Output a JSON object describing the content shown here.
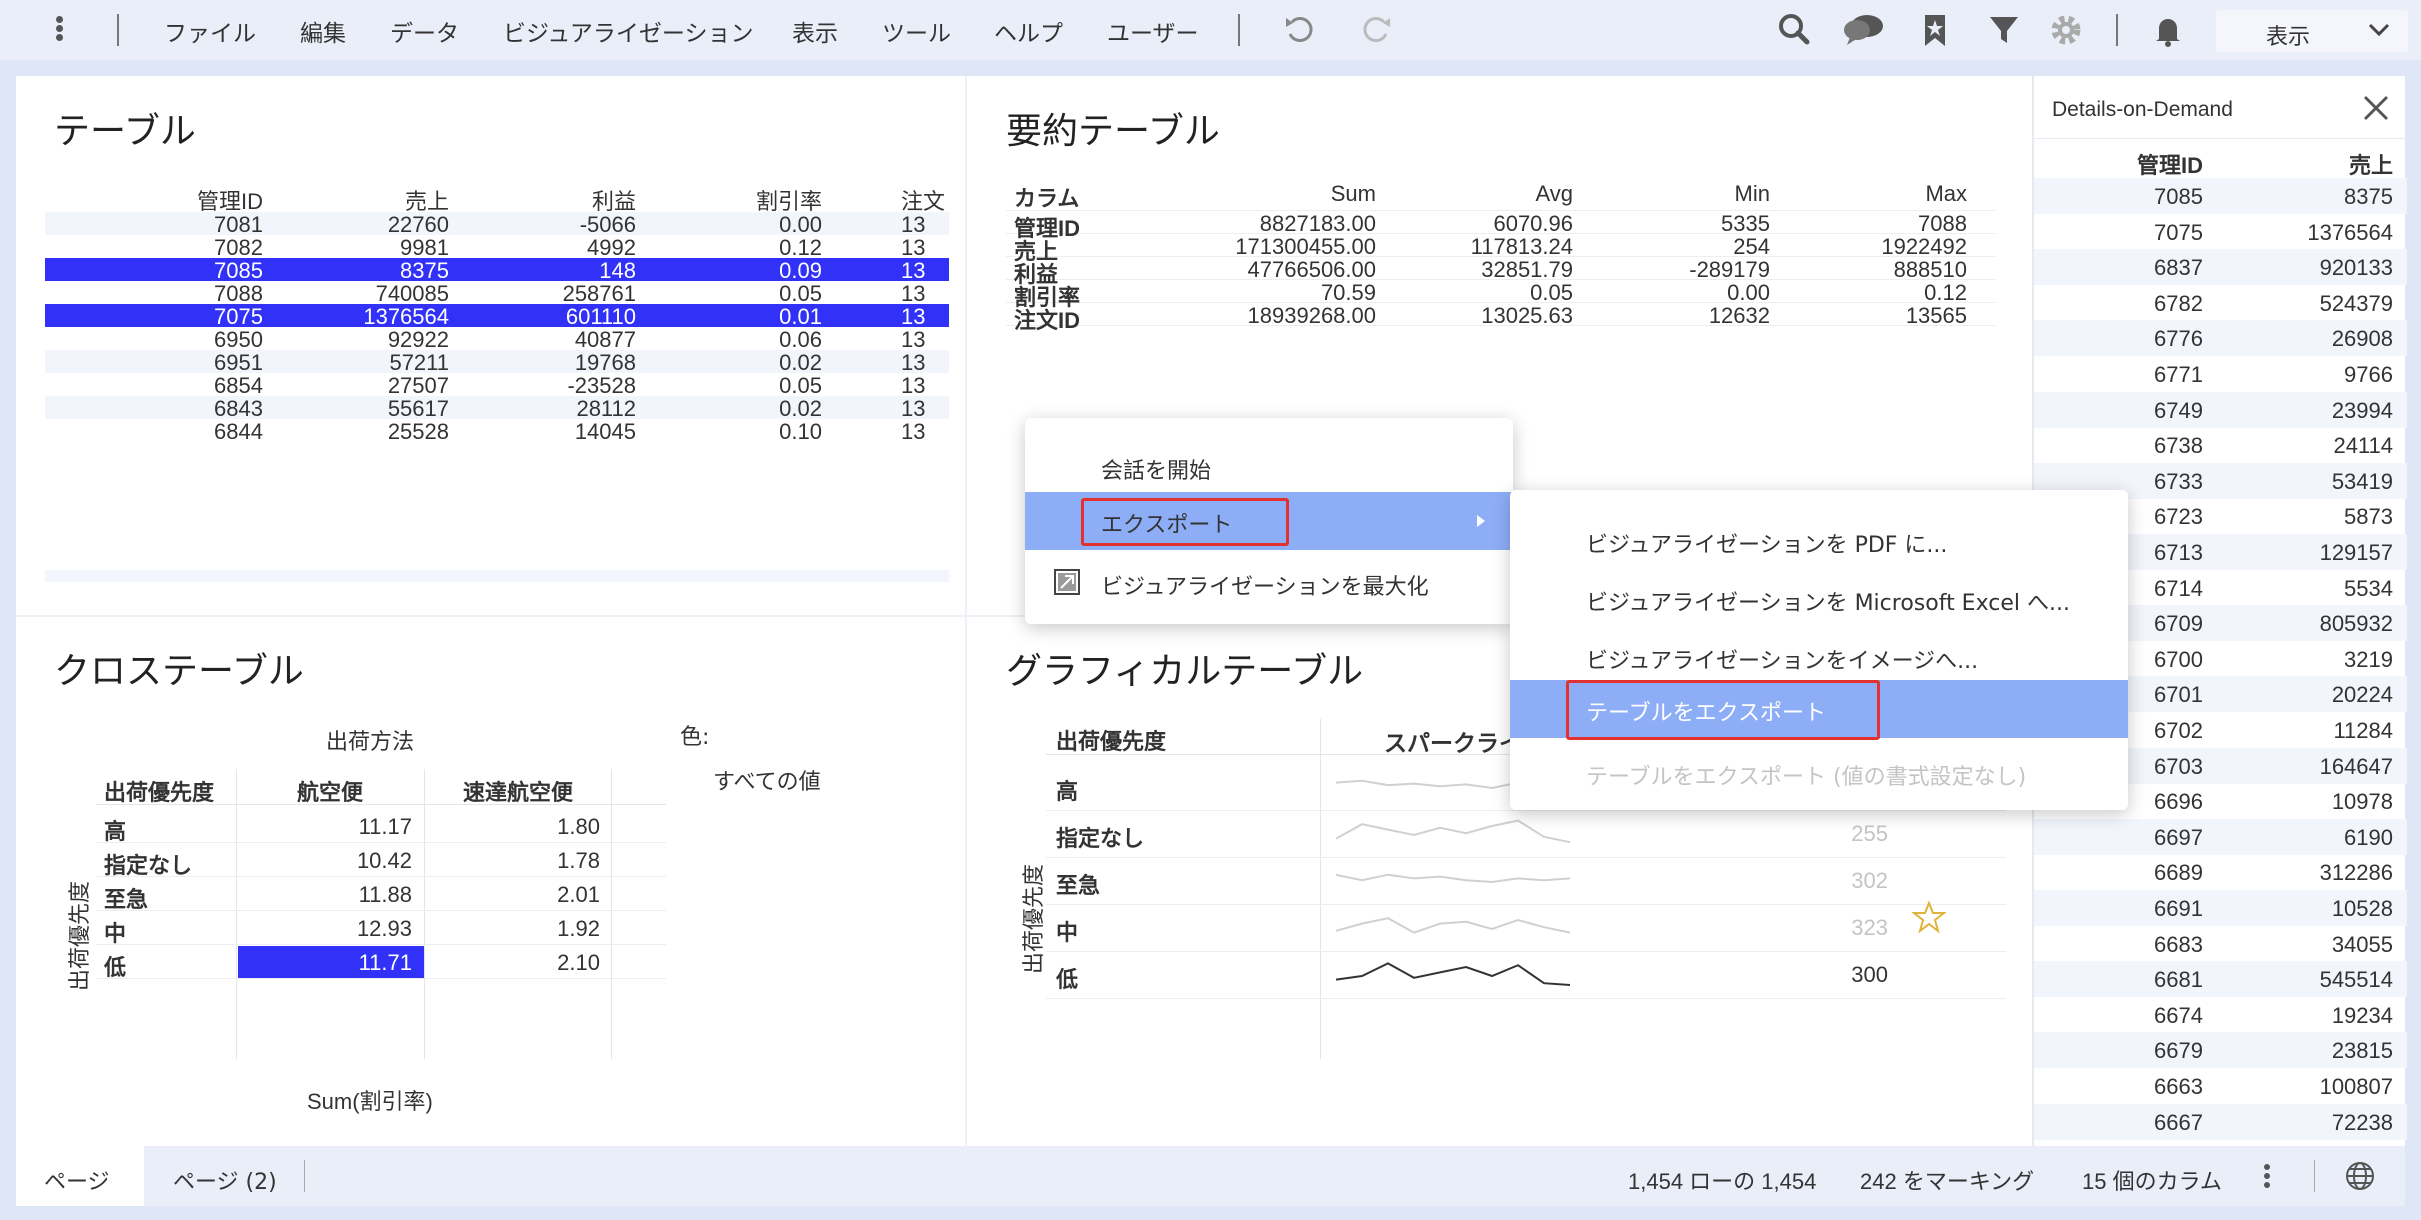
{
  "toolbar": {
    "menu": [
      "ファイル",
      "編集",
      "データ",
      "ビジュアライゼーション",
      "表示",
      "ツール",
      "ヘルプ",
      "ユーザー"
    ],
    "view_select": "表示"
  },
  "table_panel": {
    "title": "テーブル",
    "columns": [
      "管理ID",
      "売上",
      "利益",
      "割引率",
      "注文"
    ],
    "rows": [
      [
        "7081",
        "22760",
        "-5066",
        "0.00",
        "13"
      ],
      [
        "7082",
        "9981",
        "4992",
        "0.12",
        "13"
      ],
      [
        "7085",
        "8375",
        "148",
        "0.09",
        "13"
      ],
      [
        "7088",
        "740085",
        "258761",
        "0.05",
        "13"
      ],
      [
        "7075",
        "1376564",
        "601110",
        "0.01",
        "13"
      ],
      [
        "6950",
        "92922",
        "40877",
        "0.06",
        "13"
      ],
      [
        "6951",
        "57211",
        "19768",
        "0.02",
        "13"
      ],
      [
        "6854",
        "27507",
        "-23528",
        "0.05",
        "13"
      ],
      [
        "6843",
        "55617",
        "28112",
        "0.02",
        "13"
      ],
      [
        "6844",
        "25528",
        "14045",
        "0.10",
        "13"
      ]
    ],
    "selected_rows": [
      2,
      4
    ]
  },
  "summary_panel": {
    "title": "要約テーブル",
    "columns": [
      "カラム",
      "Sum",
      "Avg",
      "Min",
      "Max"
    ],
    "rows": [
      [
        "管理ID",
        "8827183.00",
        "6070.96",
        "5335",
        "7088"
      ],
      [
        "売上",
        "171300455.00",
        "117813.24",
        "254",
        "1922492"
      ],
      [
        "利益",
        "47766506.00",
        "32851.79",
        "-289179",
        "888510"
      ],
      [
        "割引率",
        "70.59",
        "0.05",
        "0.00",
        "0.12"
      ],
      [
        "注文ID",
        "18939268.00",
        "13025.63",
        "12632",
        "13565"
      ]
    ]
  },
  "cross_panel": {
    "title": "クロステーブル",
    "col_group": "出荷方法",
    "row_header": "出荷優先度",
    "columns": [
      "航空便",
      "速達航空便"
    ],
    "vertical_label": "出荷優先度",
    "rows": [
      [
        "高",
        "11.17",
        "1.80"
      ],
      [
        "指定なし",
        "10.42",
        "1.78"
      ],
      [
        "至急",
        "11.88",
        "2.01"
      ],
      [
        "中",
        "12.93",
        "1.92"
      ],
      [
        "低",
        "11.71",
        "2.10"
      ]
    ],
    "color_label": "色:",
    "color_value": "すべての値",
    "footer": "Sum(割引率)"
  },
  "graphical_panel": {
    "title": "グラフィカルテーブル",
    "row_header": "出荷優先度",
    "col_header": "スパークライ",
    "vertical_label": "出荷優先度",
    "rows": [
      {
        "label": "高",
        "value": ""
      },
      {
        "label": "指定なし",
        "value": "255"
      },
      {
        "label": "至急",
        "value": "302"
      },
      {
        "label": "中",
        "value": "323"
      },
      {
        "label": "低",
        "value": "300"
      }
    ]
  },
  "context_menu": {
    "items": [
      "会話を開始",
      "エクスポート",
      "ビジュアライゼーションを最大化"
    ],
    "highlighted": "エクスポート"
  },
  "submenu": {
    "items": [
      "ビジュアライゼーションを PDF に...",
      "ビジュアライゼーションを Microsoft Excel へ...",
      "ビジュアライゼーションをイメージへ...",
      "テーブルをエクスポート",
      "テーブルをエクスポート (値の書式設定なし)"
    ],
    "highlighted": "テーブルをエクスポート",
    "disabled": "テーブルをエクスポート (値の書式設定なし)"
  },
  "details": {
    "title": "Details-on-Demand",
    "columns": [
      "管理ID",
      "売上"
    ],
    "rows": [
      [
        "7085",
        "8375"
      ],
      [
        "7075",
        "1376564"
      ],
      [
        "6837",
        "920133"
      ],
      [
        "6782",
        "524379"
      ],
      [
        "6776",
        "26908"
      ],
      [
        "6771",
        "9766"
      ],
      [
        "6749",
        "23994"
      ],
      [
        "6738",
        "24114"
      ],
      [
        "6733",
        "53419"
      ],
      [
        "6723",
        "5873"
      ],
      [
        "6713",
        "129157"
      ],
      [
        "6714",
        "5534"
      ],
      [
        "6709",
        "805932"
      ],
      [
        "6700",
        "3219"
      ],
      [
        "6701",
        "20224"
      ],
      [
        "6702",
        "11284"
      ],
      [
        "6703",
        "164647"
      ],
      [
        "6696",
        "10978"
      ],
      [
        "6697",
        "6190"
      ],
      [
        "6689",
        "312286"
      ],
      [
        "6691",
        "10528"
      ],
      [
        "6683",
        "34055"
      ],
      [
        "6681",
        "545514"
      ],
      [
        "6674",
        "19234"
      ],
      [
        "6679",
        "23815"
      ],
      [
        "6663",
        "100807"
      ],
      [
        "6667",
        "72238"
      ]
    ]
  },
  "status": {
    "tab1": "ページ",
    "tab2": "ページ (2)",
    "rows": "1,454 ローの 1,454",
    "marked": "242 をマーキング",
    "columns": "15 個のカラム"
  },
  "colors": {
    "selection": "#3131f8",
    "menu_highlight": "#8eadf7",
    "annotation_box": "#e23131"
  }
}
